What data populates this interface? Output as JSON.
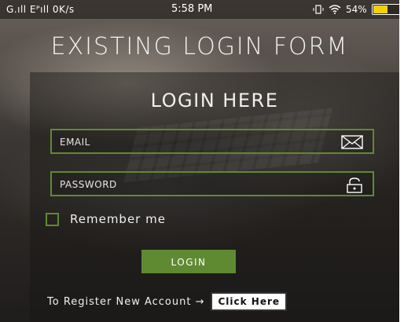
{
  "status_bar": {
    "carrier": "G.ıll Eᴾıll 0K/s",
    "time": "5:58 PM",
    "battery": "54%",
    "battery_level": 0.54,
    "battery_color": "#f3d200"
  },
  "page_title": "EXISTING LOGIN FORM",
  "form": {
    "title": "LOGIN HERE",
    "email_placeholder": "EMAIL",
    "password_placeholder": "PASSWORD",
    "remember_label": "Remember me",
    "login_label": "LOGIN",
    "register_text": "To Register New Account →",
    "click_here_label": "Click Here",
    "accent_color": "#5f8a32"
  }
}
